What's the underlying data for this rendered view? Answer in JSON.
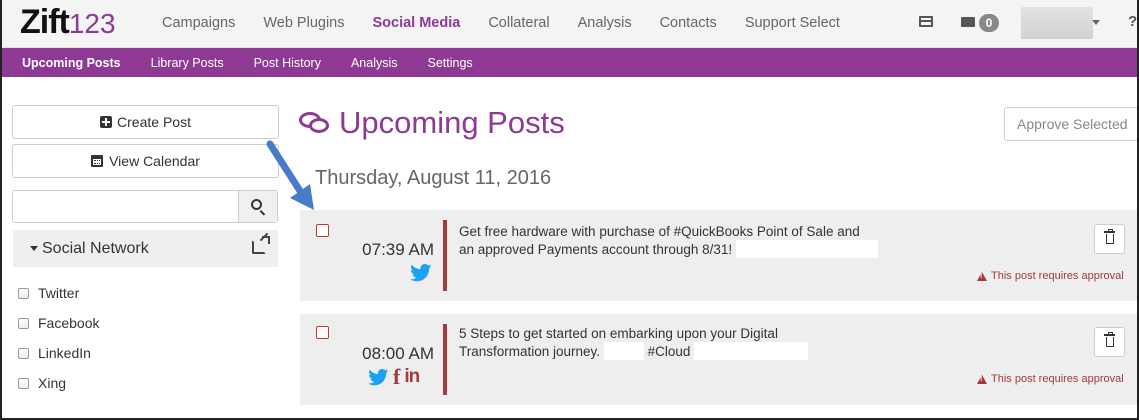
{
  "topnav": {
    "logo_main": "Zift",
    "logo_num": "123",
    "items": [
      {
        "label": "Campaigns",
        "active": false
      },
      {
        "label": "Web Plugins",
        "active": false
      },
      {
        "label": "Social Media",
        "active": true
      },
      {
        "label": "Collateral",
        "active": false
      },
      {
        "label": "Analysis",
        "active": false
      },
      {
        "label": "Contacts",
        "active": false
      },
      {
        "label": "Support Select",
        "active": false
      }
    ],
    "message_count": "0",
    "help_label": "?"
  },
  "subnav": {
    "items": [
      {
        "label": "Upcoming Posts",
        "active": true
      },
      {
        "label": "Library Posts",
        "active": false
      },
      {
        "label": "Post History",
        "active": false
      },
      {
        "label": "Analysis",
        "active": false
      },
      {
        "label": "Settings",
        "active": false
      }
    ]
  },
  "sidebar": {
    "create_post_label": "Create Post",
    "view_calendar_label": "View Calendar",
    "search": {
      "value": "",
      "placeholder": ""
    },
    "social_network_label": "Social Network",
    "networks": [
      {
        "label": "Twitter",
        "checked": false
      },
      {
        "label": "Facebook",
        "checked": false
      },
      {
        "label": "LinkedIn",
        "checked": false
      },
      {
        "label": "Xing",
        "checked": false
      }
    ]
  },
  "main": {
    "title": "Upcoming Posts",
    "approve_label": "Approve Selected",
    "date_heading": "Thursday, August 11, 2016",
    "posts": [
      {
        "time": "07:39 AM",
        "text_line1": "Get free hardware with purchase of #QuickBooks Point of Sale and",
        "text_line2": "an approved Payments account through 8/31!",
        "text_line2_extra": "",
        "networks": [
          "twitter-icon"
        ],
        "warning": "This post requires approval"
      },
      {
        "time": "08:00 AM",
        "text_line1": "5 Steps to get started on embarking upon your Digital",
        "text_line2": "Transformation journey.",
        "text_line2_extra": "#Cloud",
        "networks": [
          "twitter-icon",
          "facebook-icon",
          "linkedin-icon"
        ],
        "facebook_glyph": "f",
        "linkedin_glyph": "in",
        "warning": "This post requires approval"
      }
    ]
  },
  "colors": {
    "brand_purple": "#8e3a94",
    "approval_red": "#a23b3b",
    "twitter_blue": "#1da1f2",
    "arrow_blue": "#4a7bc8"
  }
}
